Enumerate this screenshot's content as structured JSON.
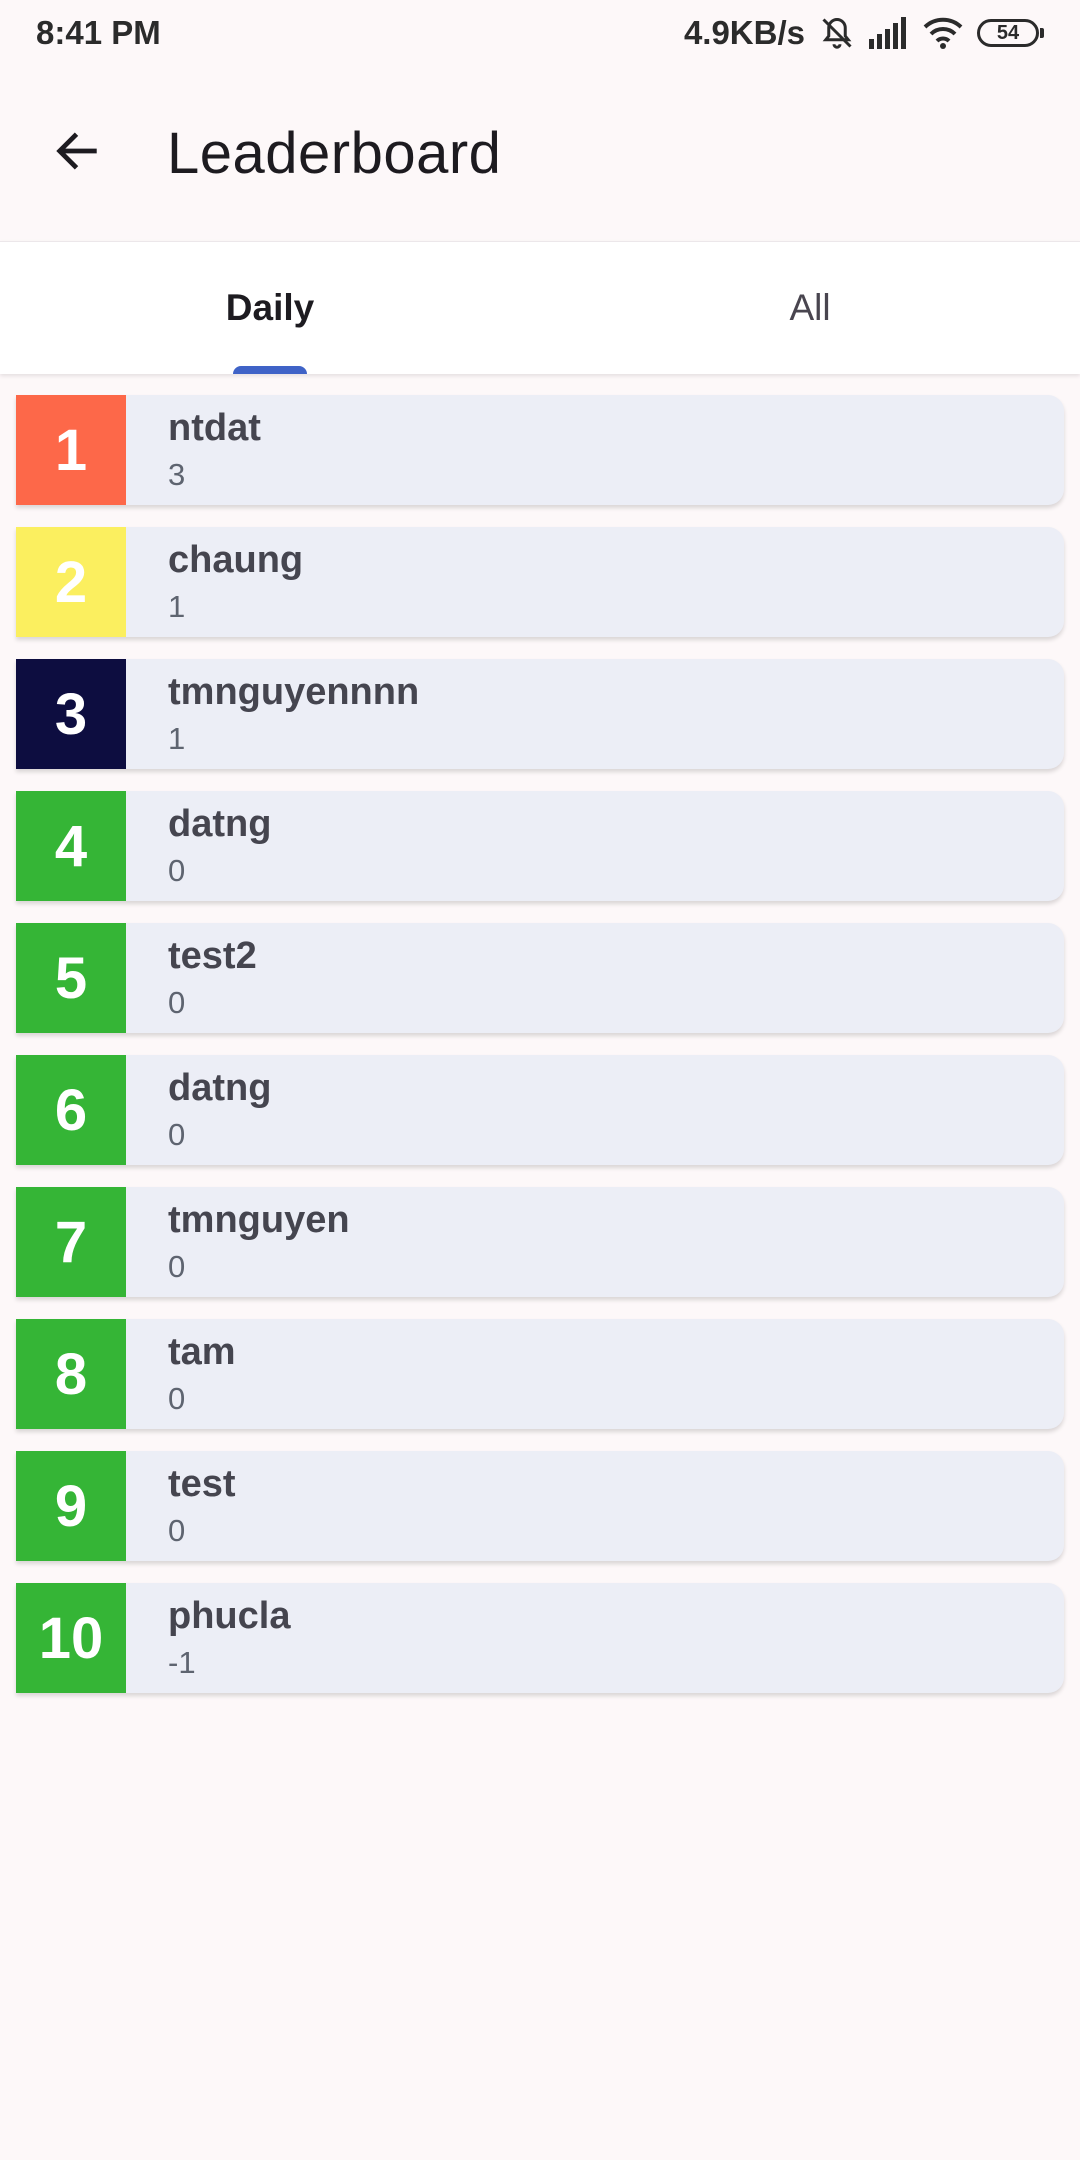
{
  "status_bar": {
    "time": "8:41 PM",
    "net_speed": "4.9KB/s",
    "battery": "54",
    "icons": [
      "mute-bell-icon",
      "signal-icon",
      "wifi-icon",
      "battery-icon"
    ]
  },
  "app_bar": {
    "back_icon": "arrow-left-icon",
    "title": "Leaderboard"
  },
  "tabs": [
    {
      "label": "Daily",
      "selected": true
    },
    {
      "label": "All",
      "selected": false
    }
  ],
  "colors": {
    "accent": "#3f63c7",
    "rank_1": "#fd6849",
    "rank_2": "#fbef5f",
    "rank_3": "#0d0d40",
    "rank_other": "#35b536",
    "card_bg": "#eceef6"
  },
  "leaderboard": [
    {
      "rank": "1",
      "name": "ntdat",
      "score": "3"
    },
    {
      "rank": "2",
      "name": "chaung",
      "score": "1"
    },
    {
      "rank": "3",
      "name": "tmnguyennnn",
      "score": "1"
    },
    {
      "rank": "4",
      "name": "datng",
      "score": "0"
    },
    {
      "rank": "5",
      "name": "test2",
      "score": "0"
    },
    {
      "rank": "6",
      "name": "datng",
      "score": "0"
    },
    {
      "rank": "7",
      "name": "tmnguyen",
      "score": "0"
    },
    {
      "rank": "8",
      "name": "tam",
      "score": "0"
    },
    {
      "rank": "9",
      "name": "test",
      "score": "0"
    },
    {
      "rank": "10",
      "name": "phucla",
      "score": "-1"
    }
  ]
}
